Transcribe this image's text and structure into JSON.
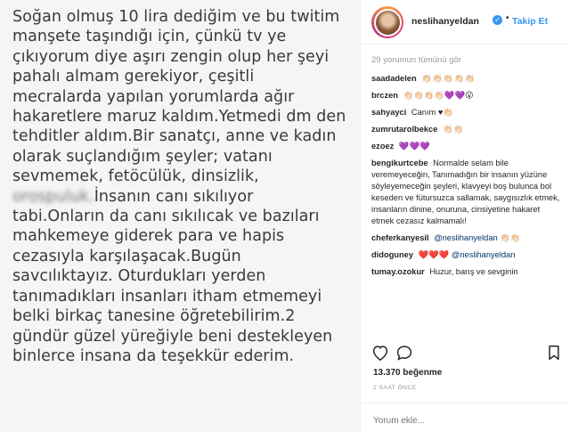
{
  "post": {
    "lines": [
      "Soğan olmuş 10 lira dediğim ve bu twitim",
      "manşete taşındığı için, çünkü tv ye",
      "çıkıyorum diye aşırı zengin olup her şeyi",
      "pahalı almam gerekiyor, çeşitli",
      "mecralarda yapılan yorumlarda ağır",
      "hakaretlere maruz kaldım.Yetmedi dm den",
      "tehditler aldım.Bir sanatçı, anne ve kadın",
      "olarak suçlandığım şeyler; vatanı",
      "sevmemek, fetöcülük, dinsizlik,",
      "",
      "tabi.Onların da canı sıkılıcak ve bazıları",
      "mahkemeye giderek para ve hapis",
      "cezasıyla karşılaşacak.Bugün",
      "savcılıktayız. Oturdukları yerden",
      "tanımadıkları insanları itham etmemeyi",
      "belki birkaç tanesine öğretebilirim.2",
      "gündür güzel yüreğiyle beni destekleyen",
      "binlerce insana da teşekkür ederim."
    ],
    "blurred_word": "orospuluk.",
    "line10_rest": "İnsanın canı sıkılıyor"
  },
  "header": {
    "username": "neslihanyeldan",
    "verified_icon": "verified-badge-icon",
    "separator": "•",
    "follow_label": "Takip Et"
  },
  "comments_section": {
    "see_all": "29 yorumun tümünü gör",
    "items": [
      {
        "user": "saadadelen",
        "text": "👏🏻👏🏻👏🏻👏🏻👏🏻"
      },
      {
        "user": "brczen",
        "text": "👏🏻👏🏻👏🏻👏🏻💜💜😮"
      },
      {
        "user": "sahyayci",
        "text": "Canım ♥︎👏🏻"
      },
      {
        "user": "zumrutarolbekce",
        "text": "👏🏻👏🏻"
      },
      {
        "user": "ezoez",
        "text": "💜💜💜"
      },
      {
        "user": "bengikurtcebe",
        "text": "Normalde selam bile veremeyeceğin, Tanımadığın bir insanın yüzüne söyleyemeceğin şeyleri, klavyeyi boş bulunca bol keseden ve fütursuzca sallamak, saygısızlık etmek, insanların dinine, onuruna, cinsiyetine hakaret etmek cezasız kalmamalı!"
      },
      {
        "user": "cheferkanyesil",
        "mention": "@neslihanyeldan",
        "text": "👏🏻👏🏻"
      },
      {
        "user": "didoguney",
        "text": "❤️❤️❤️",
        "mention": "@neslihanyeldan"
      },
      {
        "user": "tumay.ozokur",
        "text": "Huzur, barış ve sevginin"
      }
    ]
  },
  "actions": {
    "like_icon": "heart-icon",
    "comment_icon": "comment-icon",
    "save_icon": "bookmark-icon"
  },
  "likes": {
    "count": "13.370",
    "label": "beğenme"
  },
  "timestamp": "2 SAAT ÖNCE",
  "comment_input": {
    "placeholder": "Yorum ekle..."
  }
}
